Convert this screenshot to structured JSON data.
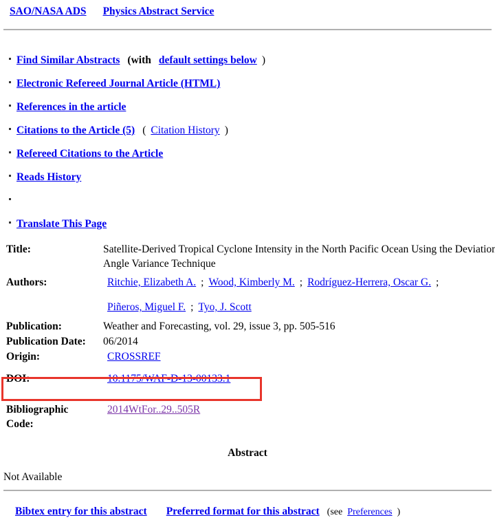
{
  "header": {
    "links": [
      {
        "label": "SAO/NASA ADS",
        "name": "sao-nasa-ads-link"
      },
      {
        "label": "Physics Abstract Service",
        "name": "physics-abstract-service-link"
      }
    ]
  },
  "link_list": [
    {
      "label": "Find Similar Abstracts",
      "suffix_open": "(with",
      "sub_link": "default settings below",
      "suffix_close": ")"
    },
    {
      "label": "Electronic Refereed Journal Article (HTML)"
    },
    {
      "label": "References in the article"
    },
    {
      "label": "Citations to the Article (5)",
      "suffix_open": "(",
      "sub_link": "Citation History",
      "suffix_close": ")"
    },
    {
      "label": "Refereed Citations to the Article"
    },
    {
      "label": "Reads History"
    },
    {
      "label": ""
    },
    {
      "label": "Translate This Page"
    }
  ],
  "record": {
    "title_label": "Title:",
    "title_value": "Satellite-Derived Tropical Cyclone Intensity in the North Pacific Ocean Using the Deviation Angle Variance Technique",
    "authors_label": "Authors:",
    "authors_line1": [
      "Ritchie, Elizabeth A.",
      "Wood, Kimberly M.",
      "Rodríguez-Herrera, Oscar G."
    ],
    "authors_line2": [
      "Piñeros, Miguel F.",
      "Tyo, J. Scott"
    ],
    "author_separator": ";",
    "publication_label": "Publication:",
    "publication_value": "Weather and Forecasting, vol. 29, issue 3, pp. 505-516",
    "publication_date_label": "Publication Date:",
    "publication_date_value": "06/2014",
    "origin_label": "Origin:",
    "origin_value": "CROSSREF",
    "doi_label": "DOI:",
    "doi_value": "10.1175/WAF-D-13-00133.1",
    "bibcode_label": "Bibliographic\nCode:",
    "bibcode_value": "2014WtFor..29..505R"
  },
  "abstract": {
    "heading": "Abstract",
    "body": "Not Available"
  },
  "footer": {
    "bibtex_link": "Bibtex entry for this abstract",
    "preferred_format_link": "Preferred format for this abstract",
    "see_open": "(see",
    "preferences_link": "Preferences",
    "see_close": ")"
  },
  "highlight": {
    "color": "#e8352b"
  }
}
